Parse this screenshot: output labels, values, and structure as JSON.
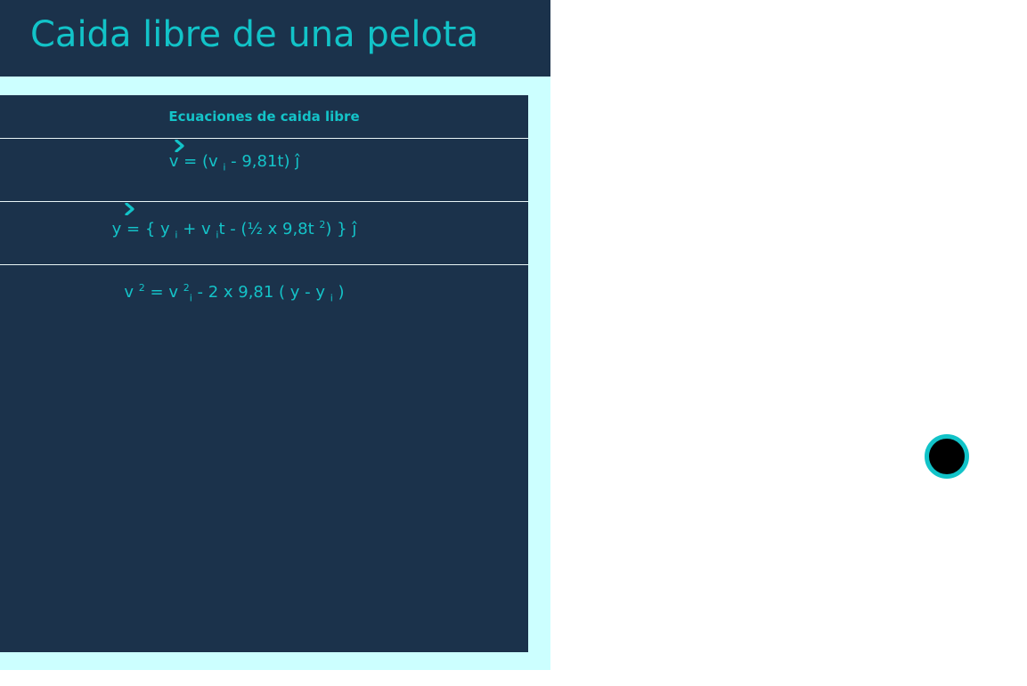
{
  "header": {
    "title": "Caida libre de una pelota"
  },
  "panel": {
    "heading": "Ecuaciones de caida libre",
    "equations": [
      {
        "parts": [
          "v = (v ",
          "i",
          " - 9,81t) ĵ"
        ]
      },
      {
        "parts": [
          "y = { y ",
          "i",
          " + v ",
          "i",
          "t - (½ x 9,8t ",
          "2",
          ") } ĵ"
        ]
      },
      {
        "parts": [
          "v ",
          "2",
          " = v ",
          "2",
          "i",
          " - 2 x 9,81 ( y - y ",
          "i",
          " )"
        ]
      }
    ]
  },
  "icons": {
    "expand": "chevron-right-icon",
    "ball": "ball-object"
  },
  "colors": {
    "accent": "#12c3c8",
    "panel_bg": "#1b324b",
    "frame_bg": "#ccffff"
  }
}
